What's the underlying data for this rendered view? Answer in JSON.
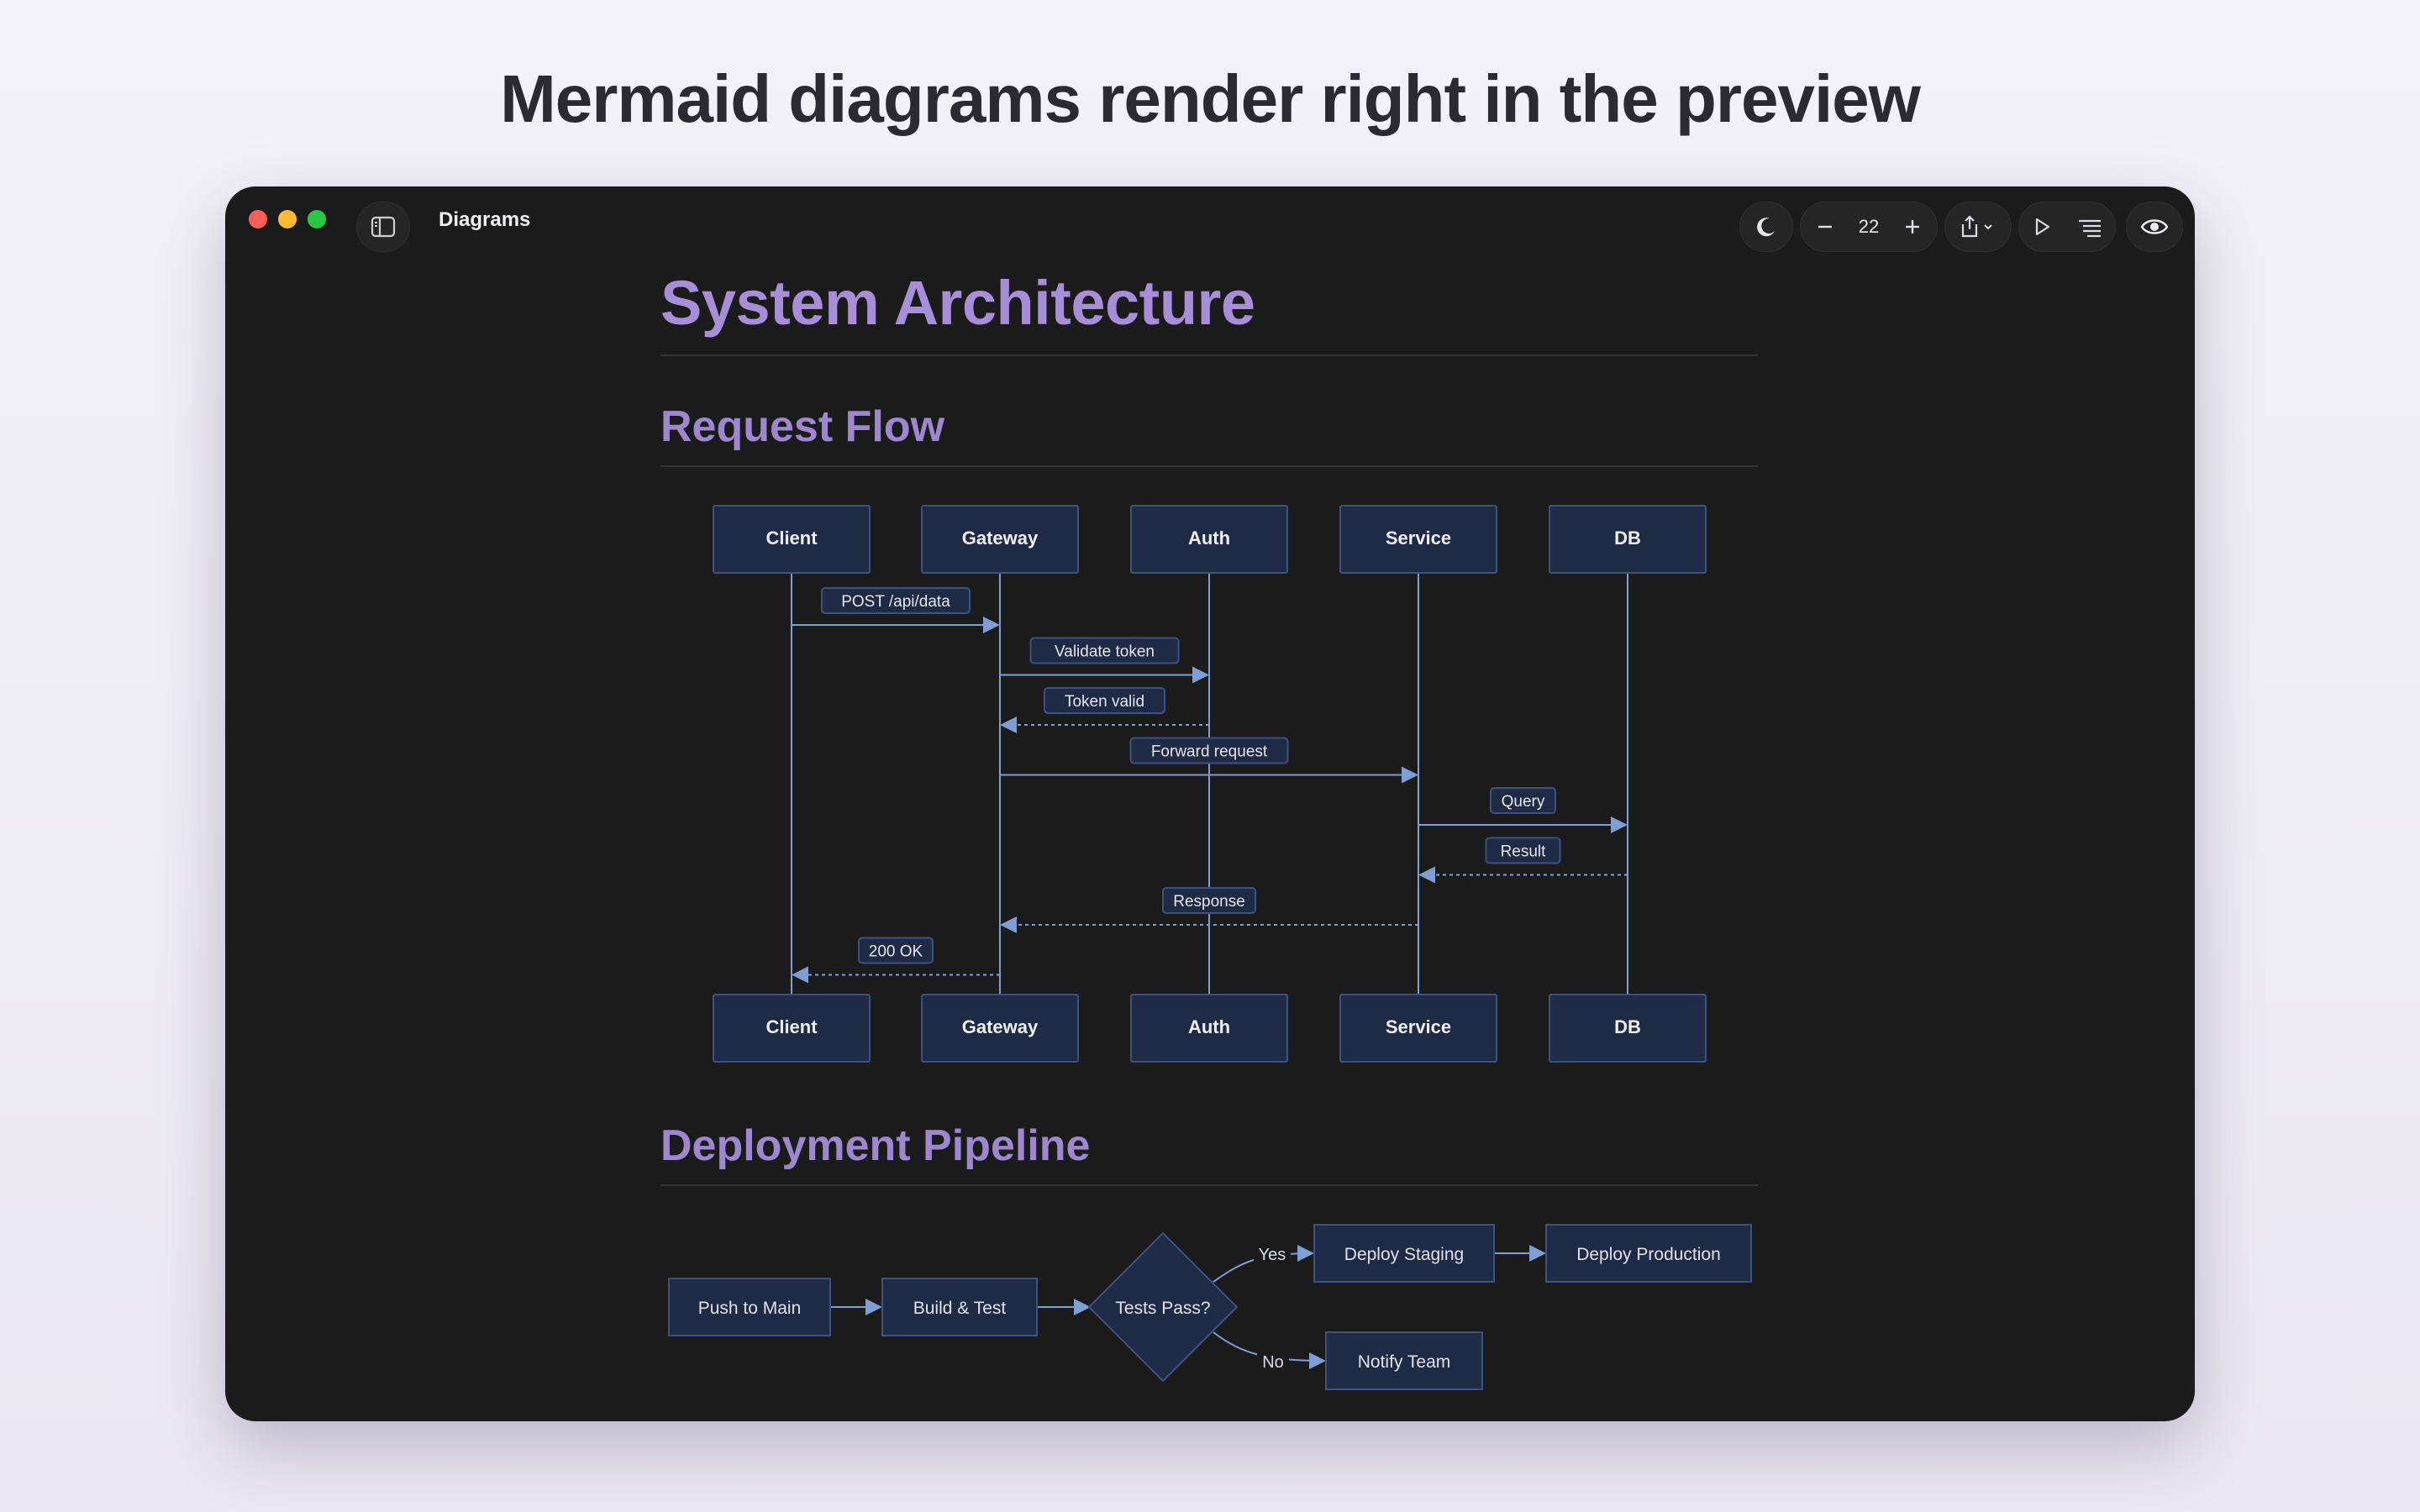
{
  "headline": "Mermaid diagrams render right in the preview",
  "window": {
    "title": "Diagrams",
    "zoom": "22",
    "traffic_lights": {
      "close": "#ff5f57",
      "minimize": "#febc2e",
      "zoom": "#28c840"
    }
  },
  "toolbar_icons": [
    "sidebar-toggle-icon",
    "moon-icon",
    "minus-icon",
    "plus-icon",
    "share-icon",
    "chevron-down-icon",
    "play-icon",
    "outline-list-icon",
    "eye-icon"
  ],
  "document": {
    "title": "System Architecture",
    "section1": "Request Flow",
    "section2": "Deployment Pipeline"
  },
  "sequence": {
    "participants": [
      "Client",
      "Gateway",
      "Auth",
      "Service",
      "DB"
    ],
    "messages": [
      {
        "from": 0,
        "to": 1,
        "label": "POST /api/data",
        "dashed": false
      },
      {
        "from": 1,
        "to": 2,
        "label": "Validate token",
        "dashed": false
      },
      {
        "from": 2,
        "to": 1,
        "label": "Token valid",
        "dashed": true
      },
      {
        "from": 1,
        "to": 3,
        "label": "Forward request",
        "dashed": false
      },
      {
        "from": 3,
        "to": 4,
        "label": "Query",
        "dashed": false
      },
      {
        "from": 4,
        "to": 3,
        "label": "Result",
        "dashed": true
      },
      {
        "from": 3,
        "to": 1,
        "label": "Response",
        "dashed": true
      },
      {
        "from": 1,
        "to": 0,
        "label": "200 OK",
        "dashed": true
      }
    ]
  },
  "flowchart": {
    "nodes": {
      "push": "Push to Main",
      "build": "Build & Test",
      "tests": "Tests Pass?",
      "staging": "Deploy Staging",
      "production": "Deploy Production",
      "notify": "Notify Team"
    },
    "edge_labels": {
      "yes": "Yes",
      "no": "No"
    }
  },
  "colors": {
    "node_fill": "#1f2a44",
    "node_stroke": "#3d5282",
    "line": "#7f9fd4",
    "heading": "#a68fd8"
  }
}
